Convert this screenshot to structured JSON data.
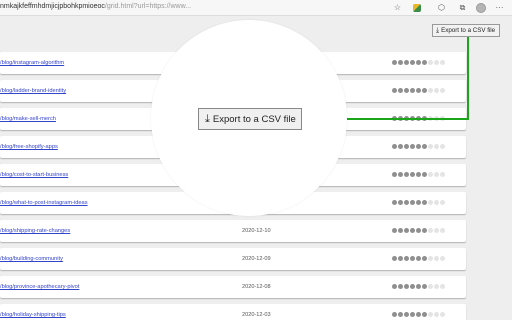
{
  "browser": {
    "url_main": "nmkajkfeffmhdmjicjpbohkpmioeoc",
    "url_dim": "/grid.html?url=https://www...",
    "icons": [
      "star-icon",
      "extension-icon",
      "cube-icon",
      "collections-icon",
      "avatar",
      "more-icon"
    ]
  },
  "export": {
    "small_label": "Export to a CSV file",
    "big_label": "Export to a CSV file",
    "icon": "download-icon"
  },
  "rows": [
    {
      "link": "/blog/instagram-algorithm",
      "date": "",
      "rating": 3
    },
    {
      "link": "/blog/ladder-brand-identity",
      "date": "",
      "rating": 3
    },
    {
      "link": "/blog/make-sell-merch",
      "date": "",
      "rating": 3
    },
    {
      "link": "/blog/free-shopify-apps",
      "date": "",
      "rating": 3
    },
    {
      "link": "/blog/cost-to-start-business",
      "date": "",
      "rating": 3
    },
    {
      "link": "/blog/what-to-post-instagram-ideas",
      "date": "",
      "rating": 3
    },
    {
      "link": "/blog/shipping-rate-changes",
      "date": "2020-12-10",
      "rating": 3
    },
    {
      "link": "/blog/building-community",
      "date": "2020-12-09",
      "rating": 3
    },
    {
      "link": "/blog/province-apothecary-pivot",
      "date": "2020-12-08",
      "rating": 3
    },
    {
      "link": "/blog/holiday-shipping-tips",
      "date": "2020-12-03",
      "rating": 3
    }
  ],
  "accent": {
    "guide_line": "#1aa51a",
    "link": "#3344cc"
  }
}
